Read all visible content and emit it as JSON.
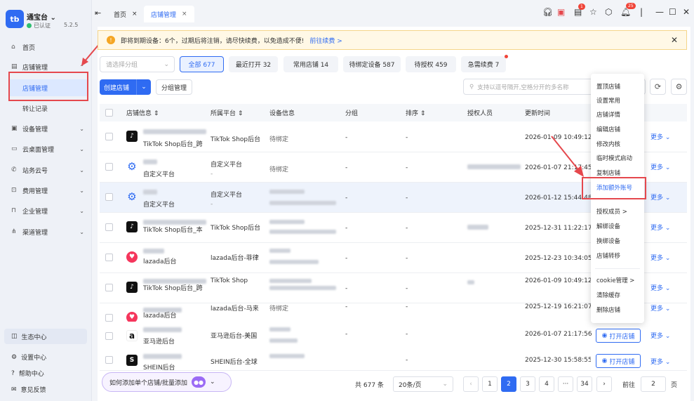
{
  "app": {
    "brand": "通宝台",
    "verified": "已认证",
    "version": "5.2.5",
    "logo_text": "tb"
  },
  "sidebar": {
    "items": [
      {
        "label": "首页",
        "icon": "home-icon"
      },
      {
        "label": "店铺管理",
        "icon": "store-icon"
      },
      {
        "label": "设备管理",
        "icon": "device-icon"
      },
      {
        "label": "云桌面管理",
        "icon": "cloud-desktop-icon"
      },
      {
        "label": "站务云号",
        "icon": "phone-icon"
      },
      {
        "label": "费用管理",
        "icon": "billing-icon"
      },
      {
        "label": "企业管理",
        "icon": "enterprise-icon"
      },
      {
        "label": "渠道管理",
        "icon": "channel-icon"
      }
    ],
    "sub_active": "店铺管理",
    "sub_2": "转让记录",
    "eco": "生态中心",
    "bottom": [
      "设置中心",
      "帮助中心",
      "意见反馈"
    ]
  },
  "tabs": {
    "home": "首页",
    "active": "店铺管理"
  },
  "topbar": {
    "badge_doc": "1",
    "badge_bell": "25"
  },
  "notice": {
    "text": "即将到期设备：6个，过期后将注销，请尽快续费，以免造成不便!",
    "link": "前往续费 >"
  },
  "filters": {
    "group_placeholder": "请选择分组",
    "chips": [
      "全部 677",
      "最近打开 32",
      "常用店铺 14",
      "待绑定设备 587",
      "待授权 459",
      "急需续费 7"
    ]
  },
  "toolbar": {
    "create": "创建店铺",
    "group": "分组管理",
    "search_placeholder": "支持以逗号隔开,空格分开的多名称"
  },
  "table": {
    "headers": [
      "店铺信息 ⇕",
      "所属平台 ⇕",
      "设备信息",
      "分组",
      "排序 ⇕",
      "授权人员",
      "更新时间"
    ],
    "rows": [
      {
        "name": "TikTok Shop后台_跨",
        "platform": "TikTok Shop后台",
        "device": "待绑定",
        "group": "-",
        "sort": "-",
        "staff": "",
        "time": "2026-01-09 10:49:12",
        "action": "更多"
      },
      {
        "name": "自定义平台",
        "platform": "自定义平台",
        "device": "待绑定",
        "group": "-",
        "sort": "-",
        "staff": "",
        "time": "2026-01-07 21:17:45",
        "action": "更多"
      },
      {
        "name": "自定义平台",
        "platform": "自定义平台",
        "device": "",
        "group": "-",
        "sort": "-",
        "staff": "",
        "time": "2026-01-12 15:44:48",
        "action": "更多"
      },
      {
        "name": "TikTok Shop后台_本",
        "platform": "TikTok Shop后台",
        "device": "",
        "group": "-",
        "sort": "-",
        "staff": "",
        "time": "2025-12-31 11:22:17",
        "action": "更多"
      },
      {
        "name": "lazada后台",
        "platform": "lazada后台-菲律",
        "device": "",
        "group": "-",
        "sort": "-",
        "staff": "",
        "time": "2025-12-23 10:34:05",
        "action": "更多"
      },
      {
        "name": "TikTok Shop后台_跨",
        "platform": "TikTok Shop",
        "device": "",
        "group": "-",
        "sort": "-",
        "staff": "",
        "time": "2026-01-09 10:49:12",
        "action": "更多"
      },
      {
        "name": "lazada后台",
        "platform": "lazada后台-马来",
        "device": "待绑定",
        "group": "-",
        "sort": "-",
        "staff": "",
        "time": "2025-12-19 16:21:07",
        "action": "更多"
      },
      {
        "name": "亚马逊后台",
        "platform": "亚马逊后台-美国",
        "device": "",
        "group": "-",
        "sort": "-",
        "staff": "",
        "time": "2026-01-07 21:17:56",
        "action": "更多",
        "open": "打开店铺"
      },
      {
        "name": "SHEIN后台",
        "platform": "SHEIN后台-全球",
        "device": "",
        "group": "-",
        "sort": "-",
        "staff": "",
        "time": "2025-12-30 15:58:55",
        "action": "更多",
        "open": "打开店铺"
      }
    ]
  },
  "menu": {
    "group1": [
      "置顶店铺",
      "设置常用",
      "店铺详情",
      "编辑店铺",
      "修改内核",
      "临时模式启动",
      "复制店铺",
      "添加额外账号"
    ],
    "group2": [
      "授权成员 >",
      "解绑设备",
      "换绑设备",
      "店铺转移"
    ],
    "group3": [
      "cookie管理 >",
      "清除缓存",
      "删除店铺"
    ]
  },
  "footer": {
    "help": "如何添加单个店铺/批量添加",
    "total": "共 677 条",
    "page_size": "20条/页",
    "pages": [
      "1",
      "2",
      "3",
      "4",
      "···",
      "34"
    ],
    "goto": "前往",
    "goto_val": "2",
    "page_unit": "页"
  },
  "colors": {
    "accent": "#2f6bf2",
    "highlight": "#e5484d",
    "tiktok": "#111111",
    "lazada": "#f5365c",
    "amazon": "#ff9900"
  }
}
